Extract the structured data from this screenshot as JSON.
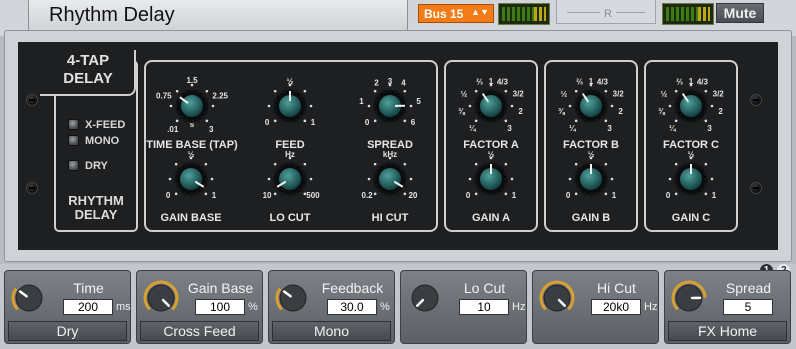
{
  "header": {
    "title": "Rhythm Delay",
    "bus": "Bus 15",
    "route_label": "R",
    "mute_label": "Mute"
  },
  "device": {
    "brand_line1": "4-TAP",
    "brand_line2": "DELAY",
    "name_line1": "RHYTHM",
    "name_line2": "DELAY",
    "switches": [
      {
        "label": "X-FEED"
      },
      {
        "label": "MONO"
      },
      {
        "label": "DRY"
      }
    ],
    "knobs": {
      "time_base": {
        "label": "TIME BASE (TAP)",
        "ticks": [
          ".01",
          "0.75",
          "1.5",
          "2.25",
          "3",
          "s"
        ]
      },
      "feed": {
        "label": "FEED",
        "ticks": [
          "0",
          "½",
          "1"
        ]
      },
      "spread": {
        "label": "SPREAD",
        "ticks": [
          "0",
          "1",
          "2",
          "3",
          "4",
          "5",
          "6"
        ]
      },
      "gain_base": {
        "label": "GAIN BASE",
        "ticks": [
          "0",
          "½",
          "1"
        ]
      },
      "lo_cut": {
        "label": "LO CUT",
        "ticks": [
          "10",
          "Hz",
          "500"
        ]
      },
      "hi_cut": {
        "label": "HI CUT",
        "ticks": [
          "0.2",
          "kHz",
          "20"
        ]
      },
      "factor_a": {
        "label": "FACTOR A",
        "ticks": [
          "¼",
          "⅜",
          "½",
          "⅔",
          "1",
          "4/3",
          "3/2",
          "2",
          "3"
        ]
      },
      "factor_b": {
        "label": "FACTOR B",
        "ticks": [
          "¼",
          "⅜",
          "½",
          "⅔",
          "1",
          "4/3",
          "3/2",
          "2",
          "3"
        ]
      },
      "factor_c": {
        "label": "FACTOR C",
        "ticks": [
          "¼",
          "⅜",
          "½",
          "⅔",
          "1",
          "4/3",
          "3/2",
          "2",
          "3"
        ]
      },
      "gain_a": {
        "label": "GAIN A",
        "ticks": [
          "0",
          "½",
          "1"
        ]
      },
      "gain_b": {
        "label": "GAIN B",
        "ticks": [
          "0",
          "½",
          "1"
        ]
      },
      "gain_c": {
        "label": "GAIN C",
        "ticks": [
          "0",
          "½",
          "1"
        ]
      }
    }
  },
  "pages": [
    "1",
    "2"
  ],
  "quick_controls": [
    {
      "name": "Time",
      "value": "200",
      "unit": "ms",
      "button": "Dry",
      "level": 0.3
    },
    {
      "name": "Gain Base",
      "value": "100",
      "unit": "%",
      "button": "Cross Feed",
      "level": 1.0
    },
    {
      "name": "Feedback",
      "value": "30.0",
      "unit": "%",
      "button": "Mono",
      "level": 0.3
    },
    {
      "name": "Lo Cut",
      "value": "10",
      "unit": "Hz",
      "button": "",
      "level": 0.0
    },
    {
      "name": "Hi Cut",
      "value": "20k0",
      "unit": "Hz",
      "button": "",
      "level": 1.0
    },
    {
      "name": "Spread",
      "value": "5",
      "unit": "",
      "button": "FX Home",
      "level": 0.83
    }
  ],
  "colors": {
    "bus": "#f37c18",
    "knob_cap": "#1f6a6a",
    "level_ring": "#d9a030",
    "panel": "#1e1f21"
  }
}
